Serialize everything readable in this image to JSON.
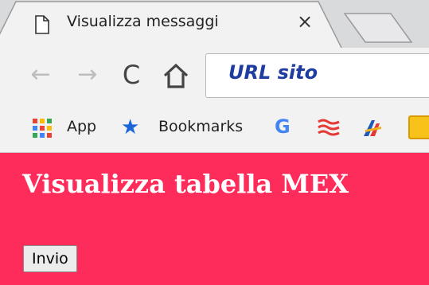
{
  "tab": {
    "title": "Visualizza messaggi",
    "close_glyph": "×"
  },
  "toolbar": {
    "back_glyph": "←",
    "forward_glyph": "→",
    "reload_glyph": "C",
    "url": "URL sito"
  },
  "bookmarks": {
    "items": [
      {
        "label": "App",
        "icon": "apps-grid-icon"
      },
      {
        "label": "Bookmarks",
        "icon": "star-icon"
      },
      {
        "label": "",
        "icon": "google-icon",
        "glyph": "G"
      },
      {
        "label": "",
        "icon": "red-flag-icon"
      },
      {
        "label": "",
        "icon": "plane-icon"
      },
      {
        "label": "",
        "icon": "yellow-bookmark-icon"
      }
    ]
  },
  "page": {
    "title": "Visualizza tabella MEX",
    "button_label": "Invio",
    "background_color": "#fe2c5a"
  },
  "colors": {
    "url_text": "#1f3da0",
    "star": "#1a66d9"
  }
}
